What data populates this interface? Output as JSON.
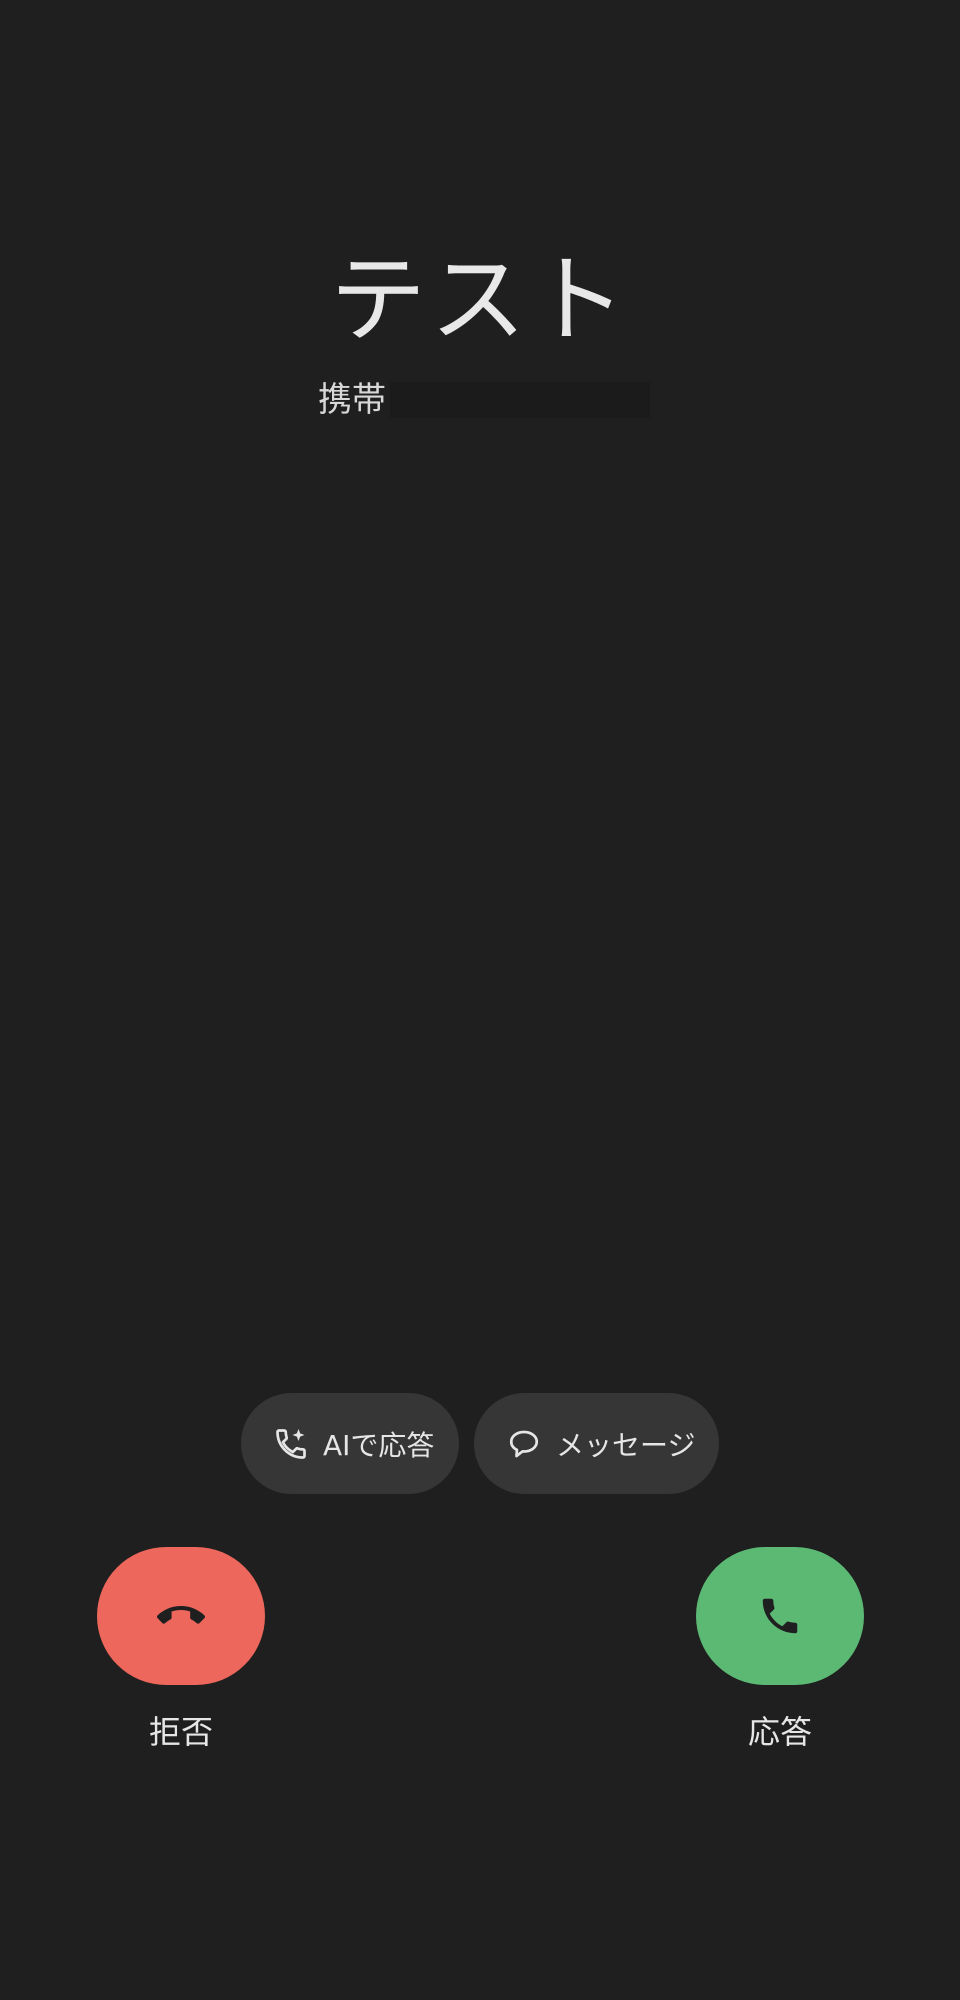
{
  "caller": {
    "name": "テスト",
    "line_type": "携帯"
  },
  "chips": {
    "ai_answer_label": "AIで応答",
    "message_label": "メッセージ"
  },
  "actions": {
    "decline_label": "拒否",
    "answer_label": "応答"
  },
  "icons": {
    "ai_answer": "phone-sparkle-icon",
    "message": "speech-bubble-icon",
    "decline": "hang-up-icon",
    "answer": "phone-icon"
  },
  "colors": {
    "background": "#1f1f1f",
    "chip": "#363636",
    "decline": "#ee675c",
    "answer": "#5bb974"
  }
}
